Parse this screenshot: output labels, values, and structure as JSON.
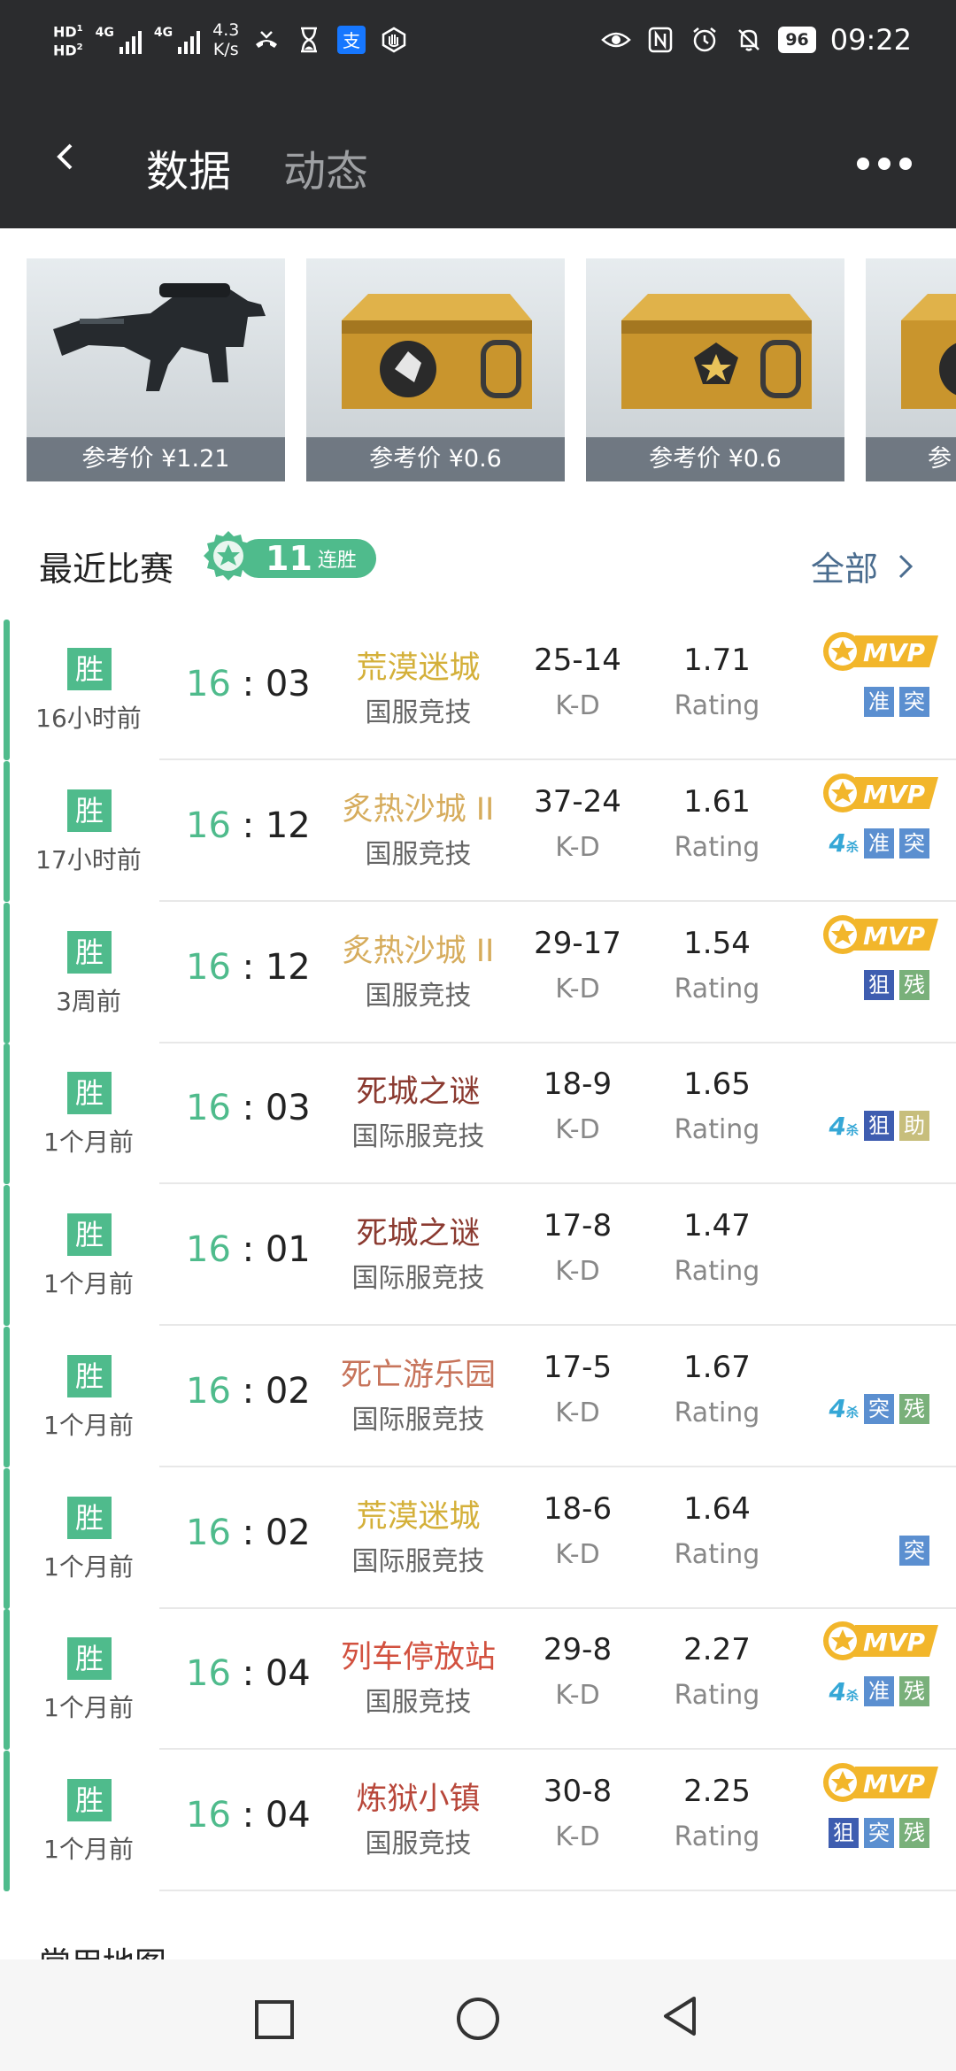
{
  "status_bar": {
    "hd1": "HD",
    "hd2": "HD",
    "sig1": "4G",
    "sig2": "4G",
    "speed_value": "4.3",
    "speed_unit": "K/s",
    "battery": "96",
    "time": "09:22",
    "icons": [
      "missed-call-icon",
      "hourglass-icon",
      "alipay-icon",
      "hand-icon",
      "eye-icon",
      "nfc-icon",
      "alarm-icon",
      "mute-icon"
    ]
  },
  "header": {
    "tab_active": "数据",
    "tab_other": "动态"
  },
  "items": [
    {
      "price": "参考价 ¥1.21",
      "kind": "rifle"
    },
    {
      "price": "参考价 ¥0.6",
      "kind": "case"
    },
    {
      "price": "参考价 ¥0.6",
      "kind": "case"
    },
    {
      "price": "参",
      "kind": "case"
    }
  ],
  "recent": {
    "title": "最近比赛",
    "streak_number": "11",
    "streak_label": "连胜",
    "all_label": "全部"
  },
  "matches": [
    {
      "result": "胜",
      "ago": "16小时前",
      "score_w": "16",
      "score_l": "03",
      "map": "荒漠迷城",
      "map_color": "#d4b03a",
      "mode": "国服竞技",
      "kd": "25-14",
      "kd_label": "K-D",
      "rating": "1.71",
      "rating_label": "Rating",
      "mvp": true,
      "kill4": false,
      "badges": [
        "准",
        "突"
      ]
    },
    {
      "result": "胜",
      "ago": "17小时前",
      "score_w": "16",
      "score_l": "12",
      "map": "炙热沙城 II",
      "map_color": "#d6ac5c",
      "mode": "国服竞技",
      "kd": "37-24",
      "kd_label": "K-D",
      "rating": "1.61",
      "rating_label": "Rating",
      "mvp": true,
      "kill4": true,
      "badges": [
        "准",
        "突"
      ]
    },
    {
      "result": "胜",
      "ago": "3周前",
      "score_w": "16",
      "score_l": "12",
      "map": "炙热沙城 II",
      "map_color": "#d6ac5c",
      "mode": "国服竞技",
      "kd": "29-17",
      "kd_label": "K-D",
      "rating": "1.54",
      "rating_label": "Rating",
      "mvp": true,
      "kill4": false,
      "badges": [
        "狙",
        "残"
      ]
    },
    {
      "result": "胜",
      "ago": "1个月前",
      "score_w": "16",
      "score_l": "03",
      "map": "死城之谜",
      "map_color": "#8b3a30",
      "mode": "国际服竞技",
      "kd": "18-9",
      "kd_label": "K-D",
      "rating": "1.65",
      "rating_label": "Rating",
      "mvp": false,
      "kill4": true,
      "badges": [
        "狙",
        "助"
      ]
    },
    {
      "result": "胜",
      "ago": "1个月前",
      "score_w": "16",
      "score_l": "01",
      "map": "死城之谜",
      "map_color": "#8b3a30",
      "mode": "国际服竞技",
      "kd": "17-8",
      "kd_label": "K-D",
      "rating": "1.47",
      "rating_label": "Rating",
      "mvp": false,
      "kill4": false,
      "badges": []
    },
    {
      "result": "胜",
      "ago": "1个月前",
      "score_w": "16",
      "score_l": "02",
      "map": "死亡游乐园",
      "map_color": "#c7745b",
      "mode": "国际服竞技",
      "kd": "17-5",
      "kd_label": "K-D",
      "rating": "1.67",
      "rating_label": "Rating",
      "mvp": false,
      "kill4": true,
      "badges": [
        "突",
        "残"
      ]
    },
    {
      "result": "胜",
      "ago": "1个月前",
      "score_w": "16",
      "score_l": "02",
      "map": "荒漠迷城",
      "map_color": "#d4b03a",
      "mode": "国际服竞技",
      "kd": "18-6",
      "kd_label": "K-D",
      "rating": "1.64",
      "rating_label": "Rating",
      "mvp": false,
      "kill4": false,
      "badges": [
        "突"
      ]
    },
    {
      "result": "胜",
      "ago": "1个月前",
      "score_w": "16",
      "score_l": "04",
      "map": "列车停放站",
      "map_color": "#d2513f",
      "mode": "国服竞技",
      "kd": "29-8",
      "kd_label": "K-D",
      "rating": "2.27",
      "rating_label": "Rating",
      "mvp": true,
      "kill4": true,
      "badges": [
        "准",
        "残"
      ]
    },
    {
      "result": "胜",
      "ago": "1个月前",
      "score_w": "16",
      "score_l": "04",
      "map": "炼狱小镇",
      "map_color": "#b8473a",
      "mode": "国服竞技",
      "kd": "30-8",
      "kd_label": "K-D",
      "rating": "2.25",
      "rating_label": "Rating",
      "mvp": true,
      "kill4": false,
      "badges": [
        "狙",
        "突",
        "残"
      ]
    }
  ],
  "badge_colors": {
    "准": "#5b8fd0",
    "突": "#5b8fd0",
    "狙": "#3e5db0",
    "残": "#79b07a",
    "助": "#c7be7c"
  },
  "mvp_label": "MVP",
  "kill4_num": "4",
  "kill4_txt": "杀",
  "common_maps": "常用地图",
  "colors": {
    "accent": "#4fbb8c",
    "header_bg": "#2b2c2e",
    "link": "#4b6d8f"
  }
}
